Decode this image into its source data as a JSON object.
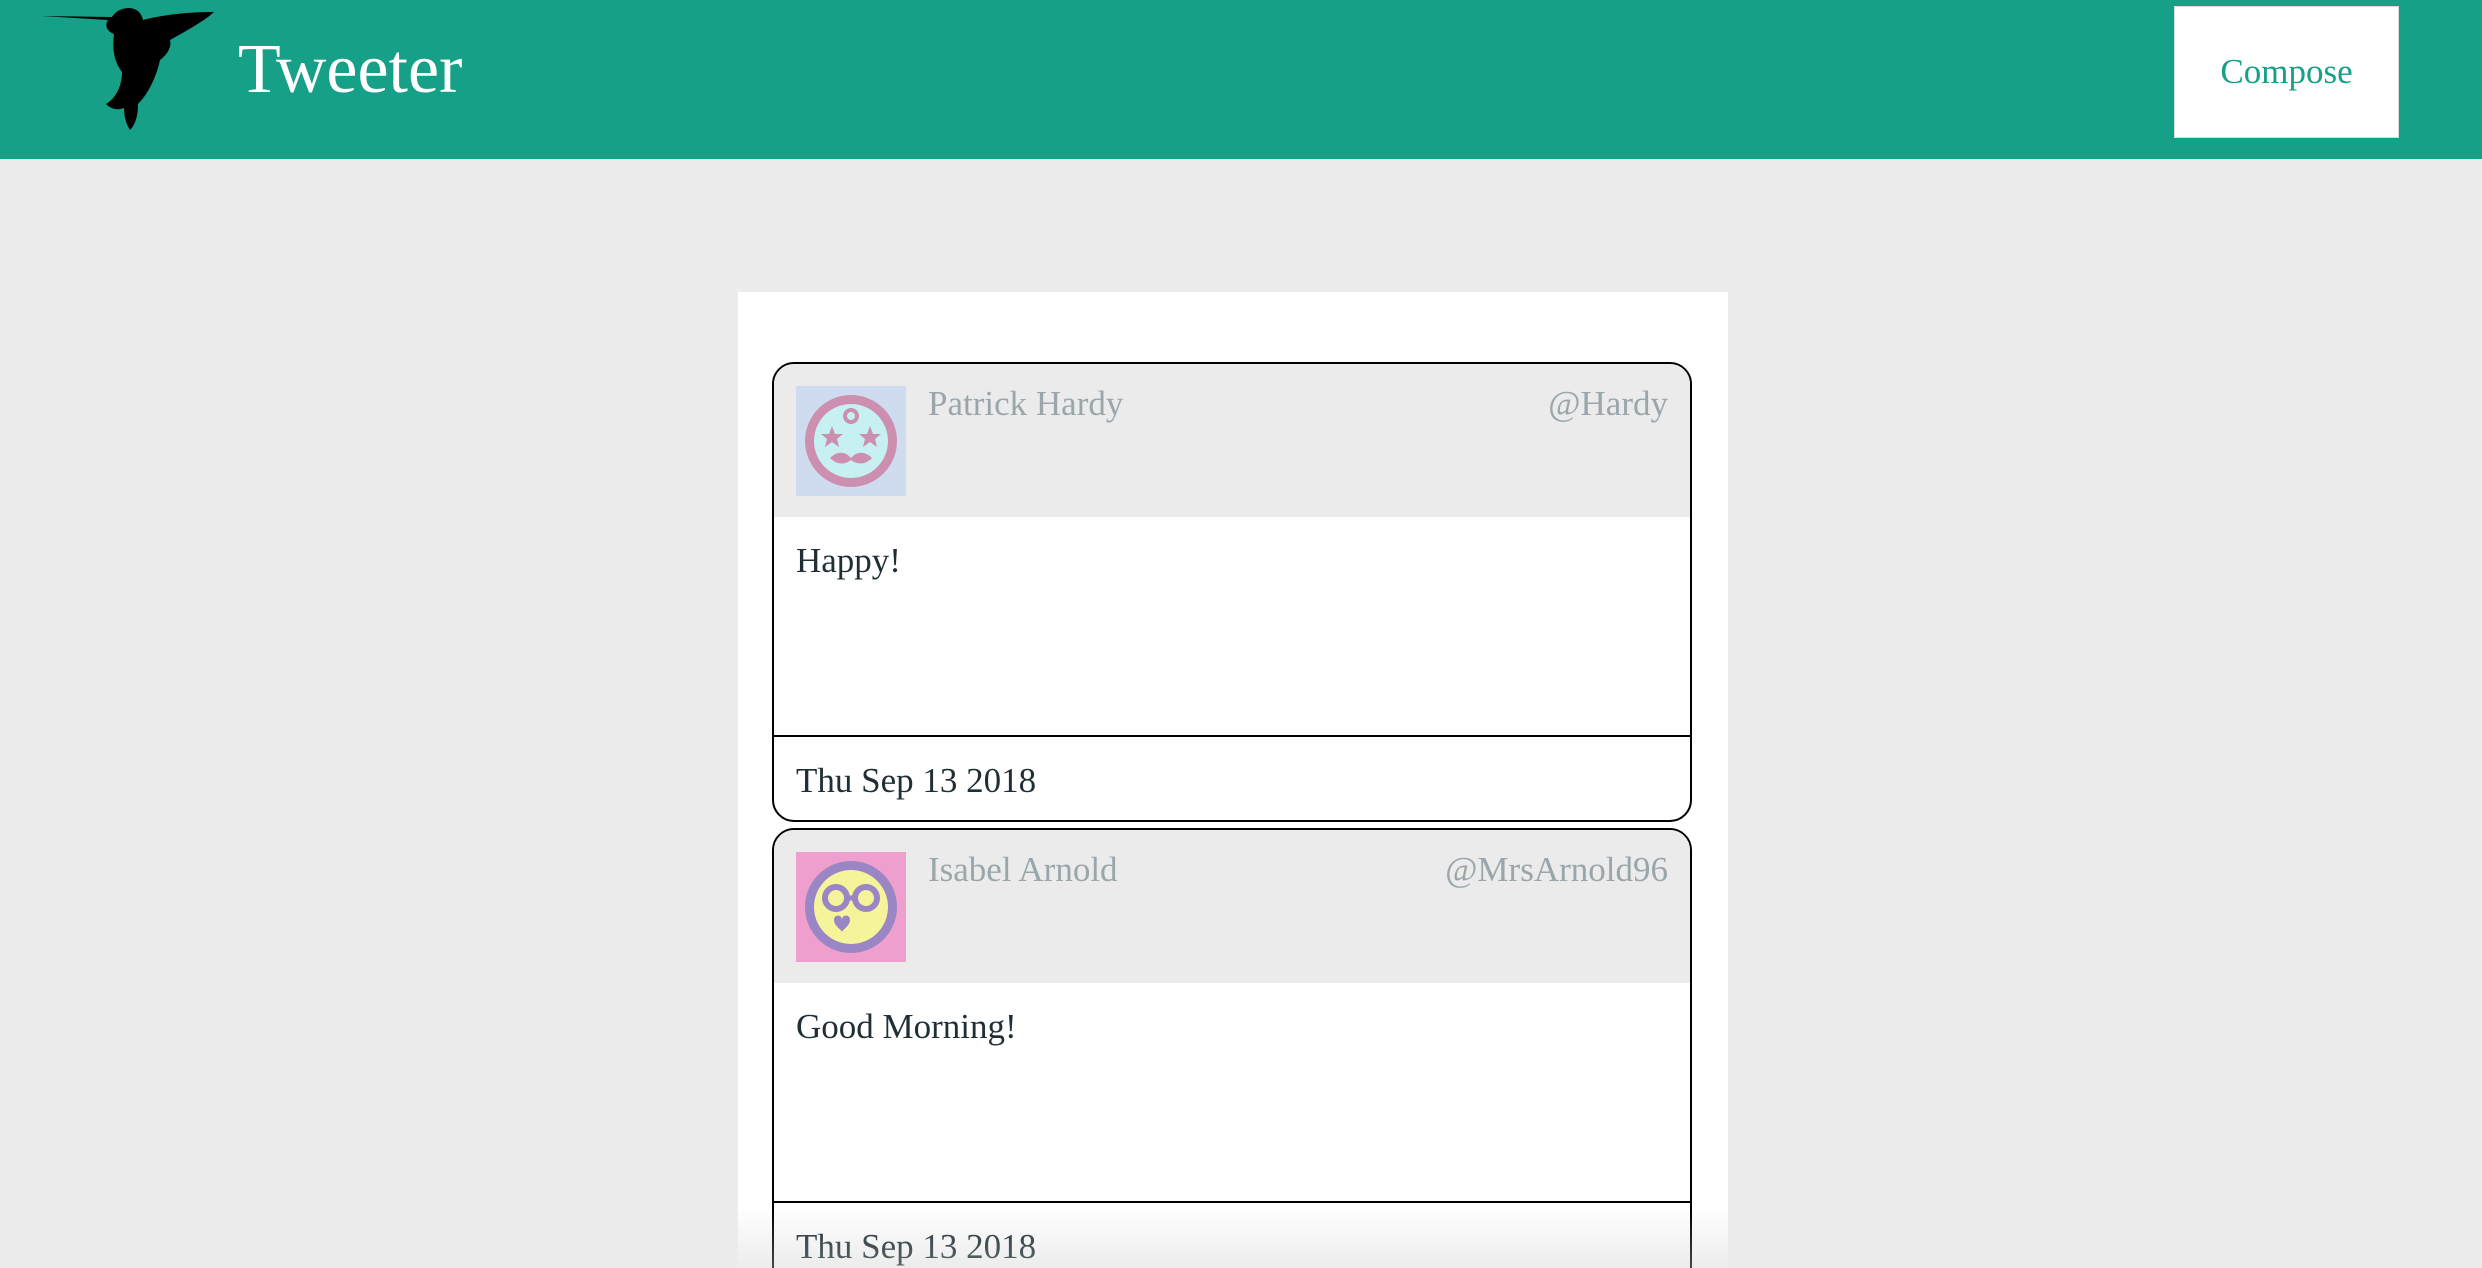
{
  "header": {
    "brand": "Tweeter",
    "compose_label": "Compose",
    "logo_icon": "hummingbird-icon"
  },
  "colors": {
    "navbar": "#17a088",
    "background": "#ececec",
    "tweet_header": "#ebebeb",
    "muted_text": "#9aa6ab",
    "body_text": "#1f2f35"
  },
  "tweets": [
    {
      "name": "Patrick Hardy",
      "handle": "@Hardy",
      "content": "Happy!",
      "date": "Thu Sep 13 2018",
      "avatar_icon": "star-mustache-avatar-icon"
    },
    {
      "name": "Isabel Arnold",
      "handle": "@MrsArnold96",
      "content": "Good Morning!",
      "date": "Thu Sep 13 2018",
      "avatar_icon": "glasses-face-avatar-icon"
    }
  ]
}
